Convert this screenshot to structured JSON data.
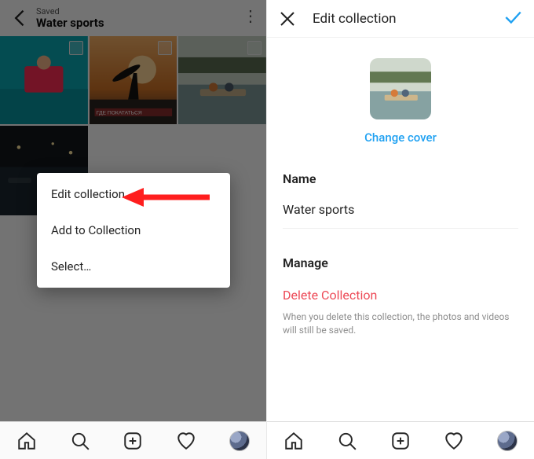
{
  "left": {
    "saved_label": "Saved",
    "title": "Water sports",
    "popup": {
      "edit": "Edit collection",
      "add": "Add to Collection",
      "select": "Select…"
    }
  },
  "right": {
    "title": "Edit collection",
    "change_cover": "Change cover",
    "name_label": "Name",
    "name_value": "Water sports",
    "manage_label": "Manage",
    "delete_label": "Delete Collection",
    "delete_hint": "When you delete this collection, the photos and videos will still be saved."
  }
}
